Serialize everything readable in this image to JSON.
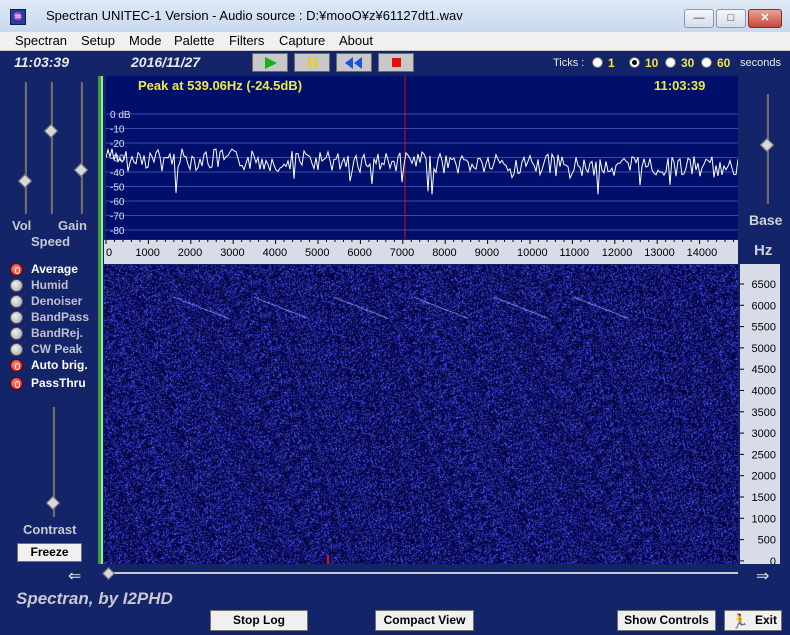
{
  "window": {
    "title": "Spectran UNITEC-1 Version  - Audio source  :  D:¥mooO¥z¥61127dt1.wav",
    "min_glyph": "—",
    "max_glyph": "□",
    "close_glyph": "✕"
  },
  "menu": {
    "items": [
      {
        "label": "Spectran"
      },
      {
        "label": "Setup"
      },
      {
        "label": "Mode"
      },
      {
        "label": "Palette"
      },
      {
        "label": "Filters"
      },
      {
        "label": "Capture"
      },
      {
        "label": "About"
      }
    ]
  },
  "status": {
    "time": "11:03:39",
    "date": "2016/11/27",
    "peak": "Peak at   539.06Hz (-24.5dB)",
    "time_right": "11:03:39"
  },
  "ticks": {
    "label": "Ticks :",
    "options": [
      "1",
      "10",
      "30",
      "60"
    ],
    "selected_index": 1,
    "unit": "seconds"
  },
  "left_panel": {
    "vol_label": "Vol",
    "gain_label": "Gain",
    "speed_label": "Speed",
    "contrast_label": "Contrast",
    "freeze_label": "Freeze",
    "options": [
      {
        "label": "Average",
        "on": true
      },
      {
        "label": "Humid",
        "on": false
      },
      {
        "label": "Denoiser",
        "on": false
      },
      {
        "label": "BandPass",
        "on": false
      },
      {
        "label": "BandRej.",
        "on": false
      },
      {
        "label": "CW Peak",
        "on": false
      },
      {
        "label": "Auto brig.",
        "on": true
      },
      {
        "label": "PassThru",
        "on": true
      }
    ]
  },
  "spectrum": {
    "db_labels": [
      "0 dB",
      "-10",
      "-20",
      "-30",
      "-40",
      "-50",
      "-60",
      "-70",
      "-80"
    ],
    "freq_labels": [
      "0",
      "1000",
      "2000",
      "3000",
      "4000",
      "5000",
      "6000",
      "7000",
      "8000",
      "9000",
      "10000",
      "11000",
      "12000",
      "13000",
      "14000"
    ],
    "hz_labels": [
      "6500",
      "6000",
      "5500",
      "5000",
      "4500",
      "4000",
      "3500",
      "3000",
      "2500",
      "2000",
      "1500",
      "1000",
      "500",
      "0"
    ],
    "base_label": "Base",
    "hz_label": "Hz"
  },
  "bottom": {
    "branding": "Spectran, by I2PHD",
    "stop_log": "Stop Log",
    "compact_view": "Compact View",
    "show_controls": "Show Controls",
    "exit": "Exit"
  }
}
